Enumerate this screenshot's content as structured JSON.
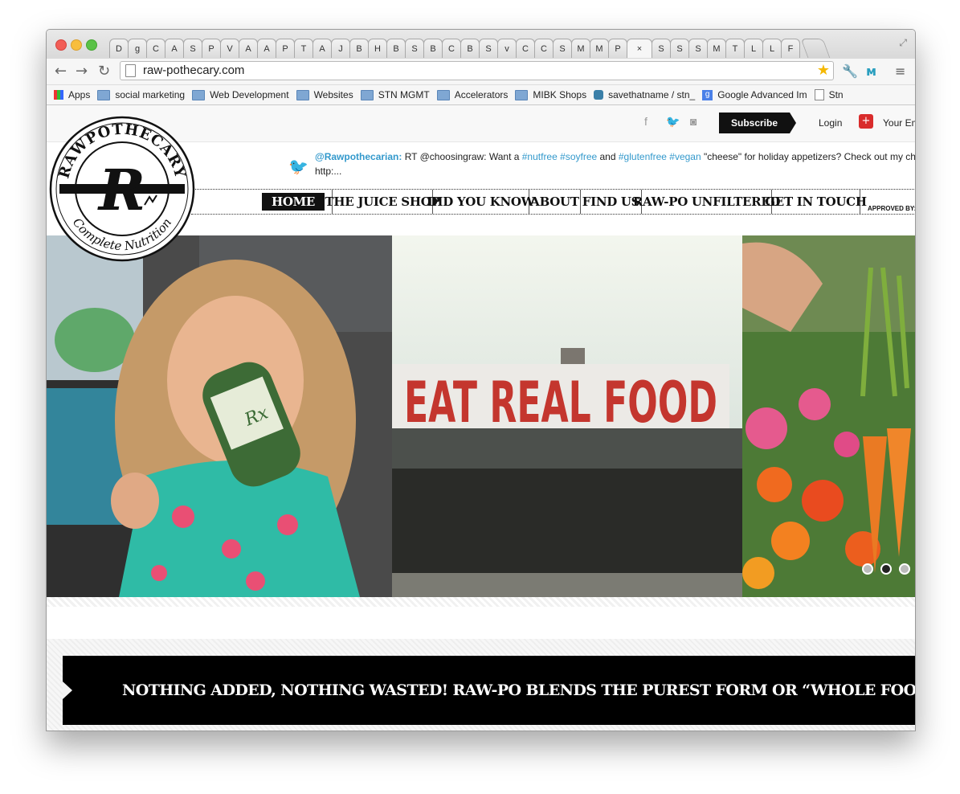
{
  "browser": {
    "tabs": [
      "D",
      "g",
      "C",
      "A",
      "S",
      "P",
      "V",
      "A",
      "A",
      "P",
      "T",
      "A",
      "J",
      "B",
      "H",
      "B",
      "S",
      "B",
      "C",
      "B",
      "S",
      "v",
      "C",
      "C",
      "S",
      "M",
      "M",
      "P",
      "×",
      "S",
      "S",
      "S",
      "M",
      "T",
      "L",
      "L",
      "F"
    ],
    "url": "raw-pothecary.com",
    "bookmarks": [
      "Apps",
      "social marketing",
      "Web Development",
      "Websites",
      "STN MGMT",
      "Accelerators",
      "MIBK Shops",
      "savethatname / stn_",
      "Google Advanced Im",
      "Stn"
    ]
  },
  "topbar": {
    "subscribe_label": "Subscribe",
    "login_label": "Login",
    "your_email_label": "Your Em"
  },
  "logo": {
    "top_text": "RAWPOTHECARY",
    "bottom_text": "Complete Nutrition",
    "monogram": "R"
  },
  "tweet": {
    "handle": "@Rawpothecarian:",
    "text1": " RT @choosingraw: Want a ",
    "tag1": "#nutfree",
    "tag2": "#soyfree",
    "text2": " and ",
    "tag3": "#glutenfree",
    "tag4": "#vegan",
    "text3": " \"cheese\" for holiday appetizers? Check out my cheesy pa",
    "text4": "http:..."
  },
  "nav": {
    "items": [
      "HOME",
      "THE JUICE SHOP",
      "DID YOU KNOW",
      "ABOUT",
      "FIND US",
      "RAW-PO UNFILTERED",
      "GET IN TOUCH"
    ],
    "approved": "APPROVED BY:"
  },
  "slider": {
    "sign_text": "EAT REAL FOOD",
    "bottle_label": "Rx",
    "dot_count": 3,
    "active_dot": 2
  },
  "banner": {
    "text": "NOTHING ADDED, NOTHING WASTED! RAW-PO BLENDS THE PUREST FORM OR “WHOLE FOOD” STATE OF GREENS AND FRU"
  }
}
